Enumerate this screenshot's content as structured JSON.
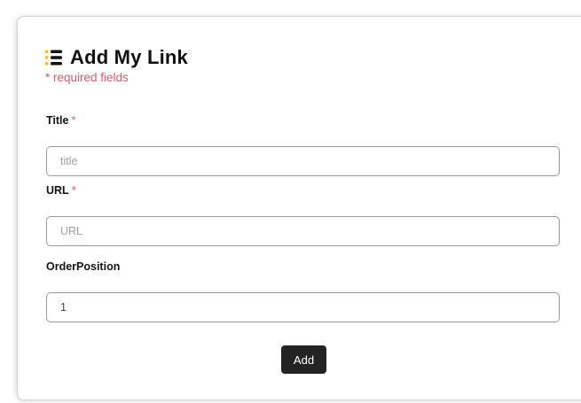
{
  "form": {
    "heading": "Add My Link",
    "required_note": "* required fields",
    "accent_color": "#FFC107",
    "required_color": "#D75C6B",
    "icon": "list-icon",
    "fields": {
      "title": {
        "label": "Title",
        "required_marker": "*",
        "placeholder": "title",
        "value": ""
      },
      "url": {
        "label": "URL",
        "required_marker": "*",
        "placeholder": "URL",
        "value": ""
      },
      "order_position": {
        "label": "OrderPosition",
        "placeholder": "",
        "value": "1"
      }
    },
    "submit_label": "Add"
  }
}
